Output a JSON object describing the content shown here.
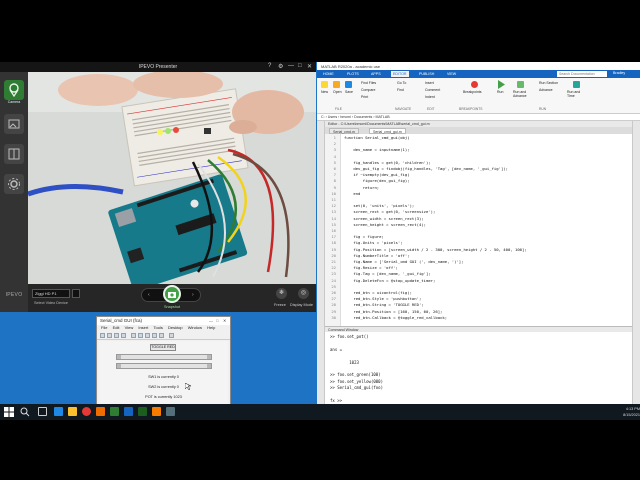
{
  "ipevo": {
    "title": "IPEVO Presenter",
    "controls": [
      "?",
      "⚙",
      "—",
      "□",
      "✕"
    ],
    "sidebar": {
      "camera_label": "Camera",
      "brand": "IPEVO"
    },
    "device_select_value": "Ziggi HD P1",
    "device_select_label": "Select Video Device",
    "snapshot_label": "Snapshot",
    "freeze_label": "Freeze",
    "display_mode_label": "Display Mode"
  },
  "figure": {
    "title": "Serial_cmd GUI (fca)",
    "menu": [
      "File",
      "Edit",
      "View",
      "Insert",
      "Tools",
      "Desktop",
      "Window",
      "Help"
    ],
    "toggle_label": "TOGGLE RED",
    "status": [
      "SW1 is currently 0",
      "SW2 is currently 0",
      "POT is currently 1023"
    ]
  },
  "matlab": {
    "title": "MATLAB R2020a - academic use",
    "tabs": [
      "HOME",
      "PLOTS",
      "APPS",
      "EDITOR",
      "PUBLISH",
      "VIEW"
    ],
    "active_tab": "EDITOR",
    "search_placeholder": "Search Documentation",
    "user": "Bradley",
    "ribbon": {
      "new": "New",
      "open": "Open",
      "save": "Save",
      "find_files": "Find Files",
      "compare": "Compare",
      "print": "Print",
      "insert": "Insert",
      "comment": "Comment",
      "indent": "Indent",
      "go_to": "Go To",
      "find": "Find",
      "breakpoints": "Breakpoints",
      "run": "Run",
      "run_and_advance": "Run and Advance",
      "run_section": "Run Section",
      "advance": "Advance",
      "run_and_time": "Run and Time",
      "sections": [
        "FILE",
        "NAVIGATE",
        "EDIT",
        "BREAKPOINTS",
        "RUN"
      ]
    },
    "path": "C: › Users › bmcmi › Documents › MATLAB",
    "editor_header": "Editor - C:\\Users\\bmcmi\\Documents\\MATLAB\\serial_cmd_gui.m",
    "editor_tabs": [
      "Serial_cmd.m",
      "Serial_cmd_gui.m"
    ],
    "active_editor_tab": "Serial_cmd_gui.m",
    "code": [
      [
        "1",
        "function Serial_cmd_gui(obj)"
      ],
      [
        "2",
        ""
      ],
      [
        "3",
        "    dev_name = inputname(1);"
      ],
      [
        "4",
        ""
      ],
      [
        "5",
        "    fig_handles = get(0, 'children');"
      ],
      [
        "6",
        "    dev_gui_fig = findobj(fig_handles, 'Tag', [dev_name, '_gui_fig']);"
      ],
      [
        "7",
        "    if ~isempty(dev_gui_fig)"
      ],
      [
        "8",
        "        figure(dev_gui_fig);"
      ],
      [
        "9",
        "        return;"
      ],
      [
        "10",
        "    end"
      ],
      [
        "11",
        ""
      ],
      [
        "12",
        "    set(0, 'units', 'pixels');"
      ],
      [
        "13",
        "    screen_rect = get(0, 'screensize');"
      ],
      [
        "14",
        "    screen_width = screen_rect(3);"
      ],
      [
        "15",
        "    screen_height = screen_rect(4);"
      ],
      [
        "16",
        ""
      ],
      [
        "17",
        "    fig = figure;"
      ],
      [
        "18",
        "    fig.Units = 'pixels';"
      ],
      [
        "19",
        "    fig.Position = [screen_width / 2 - 300, screen_height / 2 - 50, 400, 100];"
      ],
      [
        "20",
        "    fig.NumberTitle = 'off';"
      ],
      [
        "21",
        "    fig.Name = ['Serial_cmd GUI (', dev_name, ')'];"
      ],
      [
        "22",
        "    fig.Resize = 'off';"
      ],
      [
        "23",
        "    fig.Tag = [dev_name, '_gui_fig'];"
      ],
      [
        "24",
        "    fig.DeleteFcn = @stop_update_timer;"
      ],
      [
        "25",
        ""
      ],
      [
        "26",
        "    red_btn = uicontrol(fig);"
      ],
      [
        "27",
        "    red_btn.Style = 'pushbutton';"
      ],
      [
        "28",
        "    red_btn.String = 'TOGGLE RED';"
      ],
      [
        "29",
        "    red_btn.Position = [160, 150, 60, 26];"
      ],
      [
        "30",
        "    red_btn.Callback = @toggle_red_callback;"
      ]
    ],
    "cw_header": "Command Window",
    "command_window": [
      ">> foo.set_pot()",
      "",
      "ans =",
      "",
      "        1023",
      "",
      ">> foo.set_green(100)",
      ">> foo.set_yellow(000)",
      ">> Serial_cmd_gui(foo)",
      "",
      "fx >>"
    ]
  },
  "taskbar": {
    "time": "4:13 PM",
    "date": "8/15/2021"
  }
}
